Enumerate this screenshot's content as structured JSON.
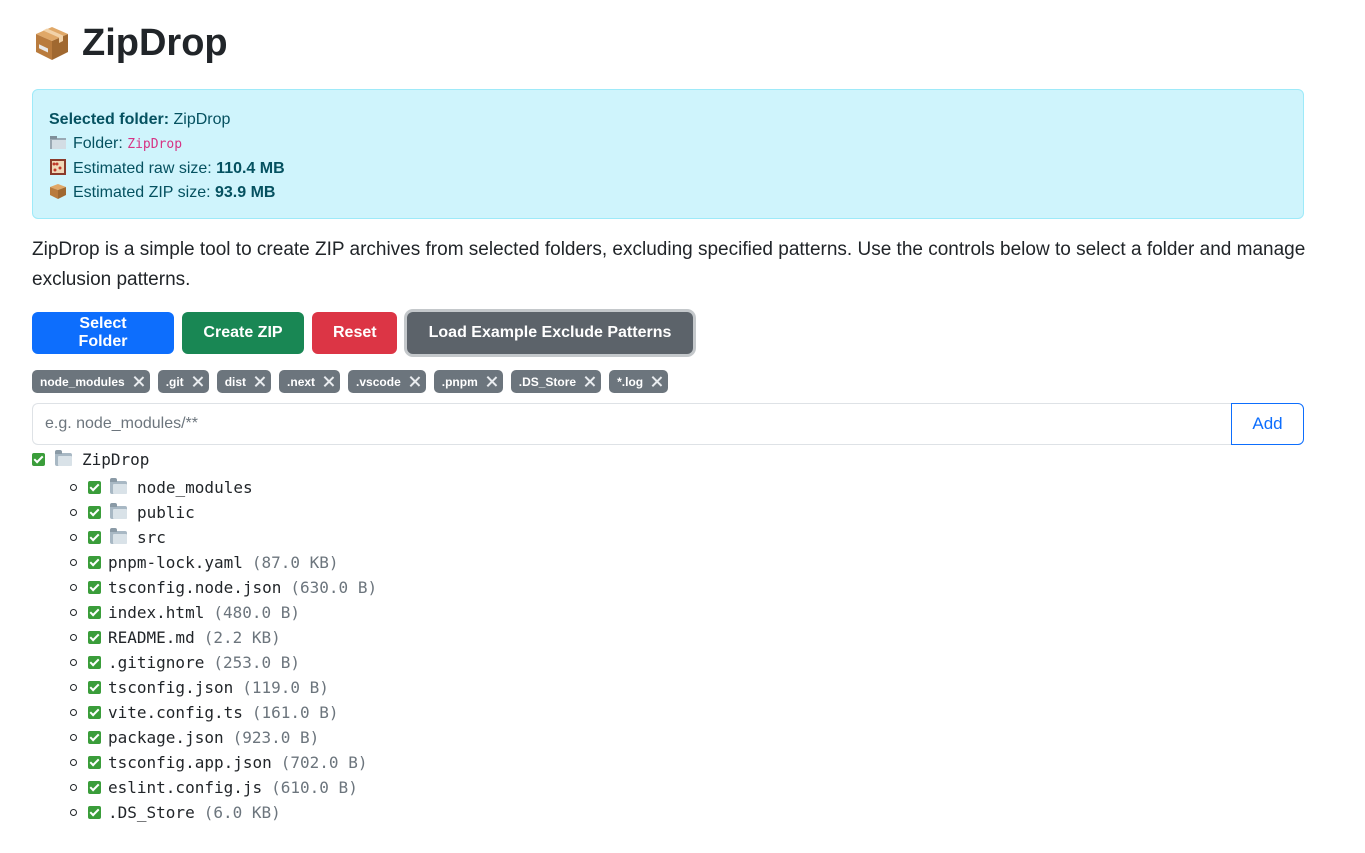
{
  "app": {
    "title": "ZipDrop",
    "icon": "package-icon"
  },
  "info": {
    "selected_label": "Selected folder:",
    "selected_value": "ZipDrop",
    "folder_label": "Folder:",
    "folder_value": "ZipDrop",
    "raw_label": "Estimated raw size:",
    "raw_value": "110.4 MB",
    "zip_label": "Estimated ZIP size:",
    "zip_value": "93.9 MB"
  },
  "description": "ZipDrop is a simple tool to create ZIP archives from selected folders, excluding specified patterns. Use the controls below to select a folder and manage exclusion patterns.",
  "buttons": {
    "select_folder": "Select Folder",
    "create_zip": "Create ZIP",
    "reset": "Reset",
    "load_examples": "Load Example Exclude Patterns"
  },
  "exclude_patterns": [
    "node_modules",
    ".git",
    "dist",
    ".next",
    ".vscode",
    ".pnpm",
    ".DS_Store",
    "*.log"
  ],
  "pattern_input": {
    "placeholder": "e.g. node_modules/**",
    "value": "",
    "add_label": "Add"
  },
  "tree": {
    "root": "ZipDrop",
    "children": [
      {
        "name": "node_modules",
        "type": "folder",
        "size": ""
      },
      {
        "name": "public",
        "type": "folder",
        "size": ""
      },
      {
        "name": "src",
        "type": "folder",
        "size": ""
      },
      {
        "name": "pnpm-lock.yaml",
        "type": "file",
        "size": "(87.0 KB)"
      },
      {
        "name": "tsconfig.node.json",
        "type": "file",
        "size": "(630.0 B)"
      },
      {
        "name": "index.html",
        "type": "file",
        "size": "(480.0 B)"
      },
      {
        "name": "README.md",
        "type": "file",
        "size": "(2.2 KB)"
      },
      {
        "name": ".gitignore",
        "type": "file",
        "size": "(253.0 B)"
      },
      {
        "name": "tsconfig.json",
        "type": "file",
        "size": "(119.0 B)"
      },
      {
        "name": "vite.config.ts",
        "type": "file",
        "size": "(161.0 B)"
      },
      {
        "name": "package.json",
        "type": "file",
        "size": "(923.0 B)"
      },
      {
        "name": "tsconfig.app.json",
        "type": "file",
        "size": "(702.0 B)"
      },
      {
        "name": "eslint.config.js",
        "type": "file",
        "size": "(610.0 B)"
      },
      {
        "name": ".DS_Store",
        "type": "file",
        "size": "(6.0 KB)"
      }
    ]
  }
}
